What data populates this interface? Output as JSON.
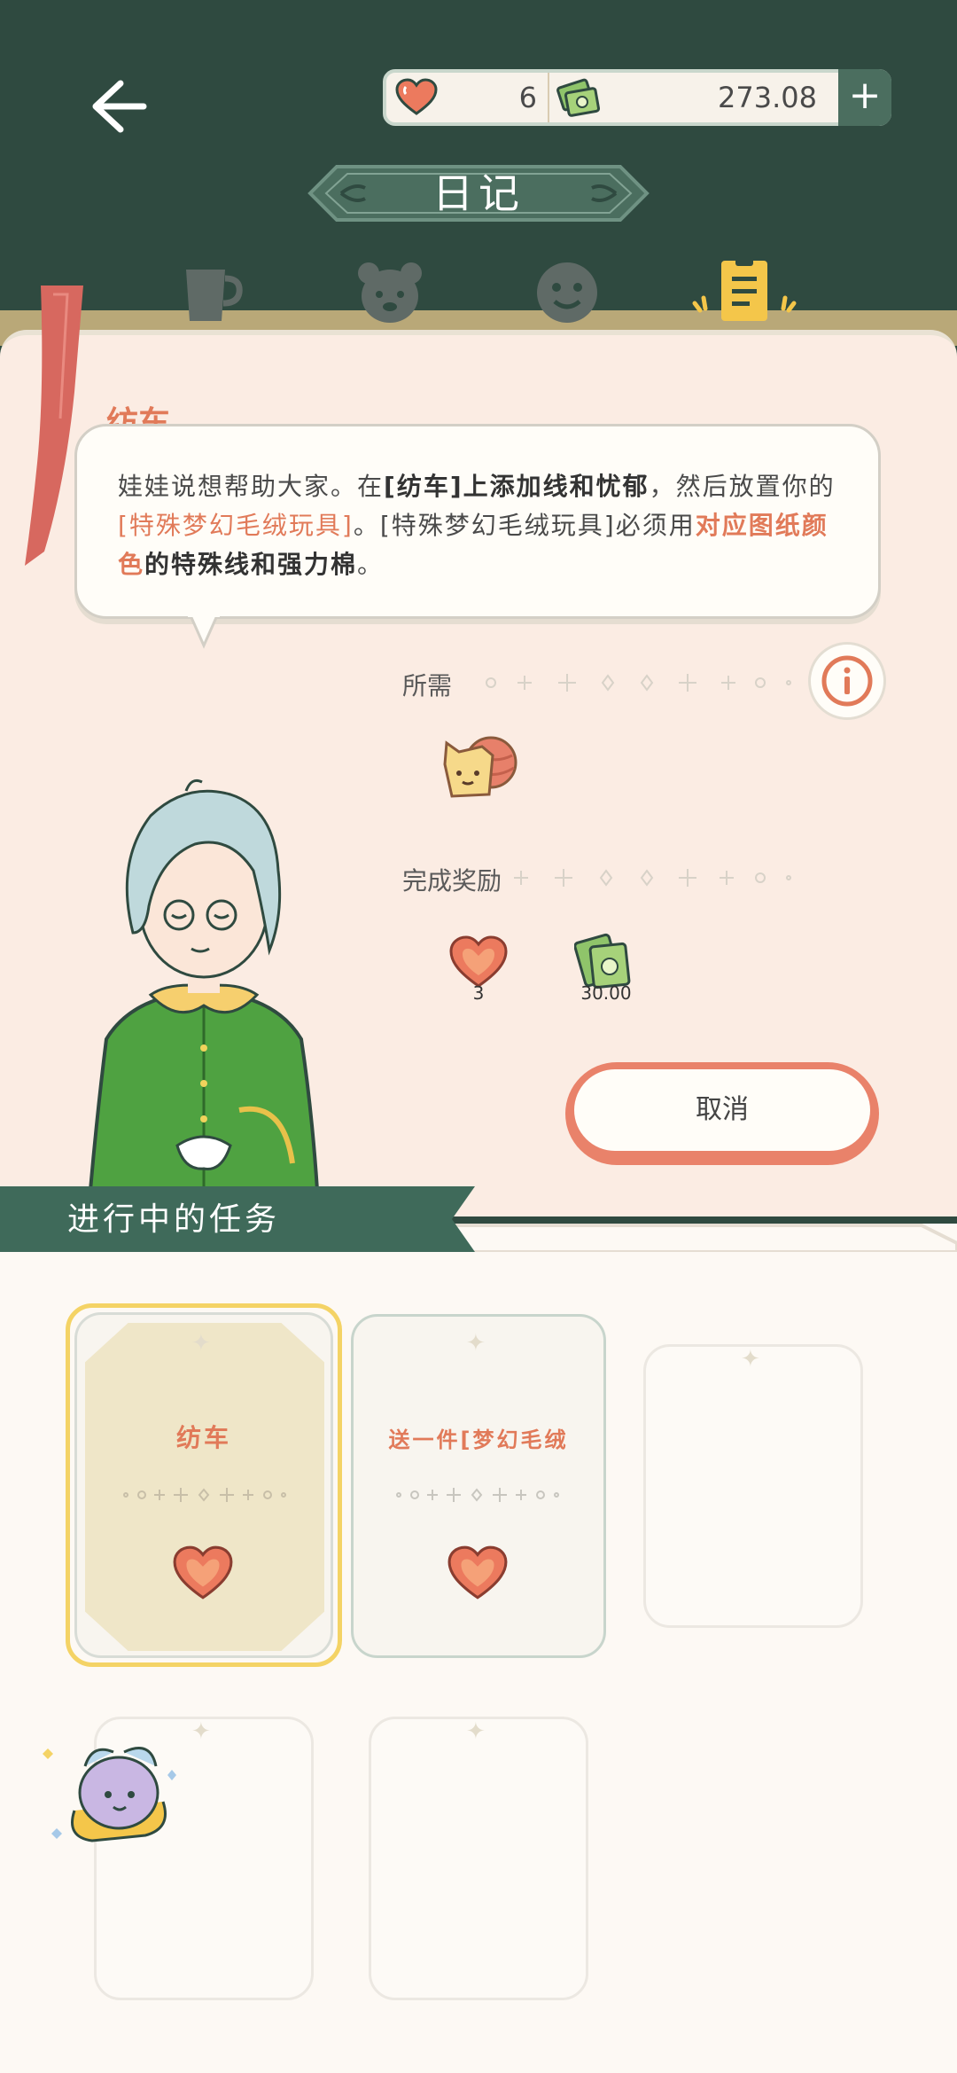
{
  "header": {
    "title": "日记",
    "hearts": "6",
    "money": "273.08",
    "plus_label": "+"
  },
  "tabs": [
    {
      "icon": "mug-icon"
    },
    {
      "icon": "bear-icon"
    },
    {
      "icon": "smiley-icon"
    },
    {
      "icon": "diary-icon",
      "active": true
    }
  ],
  "quest": {
    "title": "纺车",
    "description_parts": [
      "娃娃说想帮助大家。在",
      "[纺车]上添加线和忧郁",
      "，然后放置你的",
      "[特殊梦幻毛绒玩具]",
      "。[特殊梦幻毛绒玩具]必须用",
      "对应图纸颜色",
      "的特殊线和强力棉",
      "。"
    ],
    "required_label": "所需",
    "reward_label": "完成奖励",
    "reward_hearts": "3",
    "reward_money": "30.00",
    "cancel_label": "取消"
  },
  "ongoing": {
    "section_title": "进行中的任务",
    "cards": [
      {
        "title": "纺车",
        "selected": true
      },
      {
        "title": "送一件[梦幻毛绒"
      }
    ]
  },
  "colors": {
    "dark_green": "#2f4a40",
    "accent_orange": "#e17a59",
    "panel_pink": "#fbece3",
    "highlight_yellow": "#f4d365"
  }
}
